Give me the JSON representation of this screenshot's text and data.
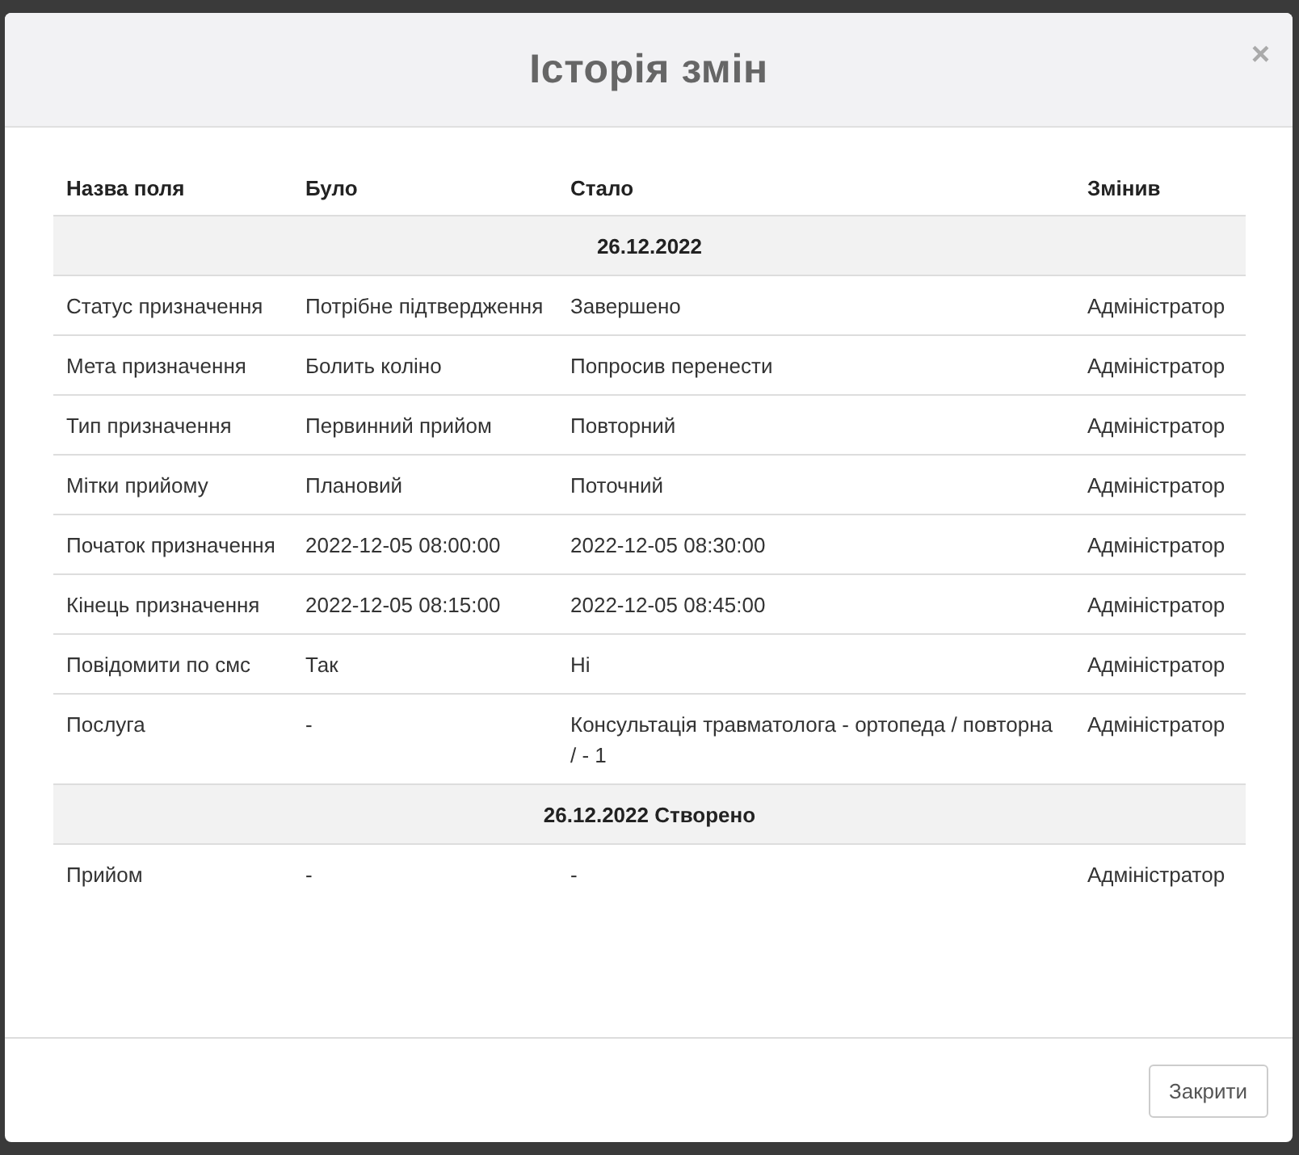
{
  "dialog": {
    "title": "Історія змін",
    "close_icon": "×"
  },
  "table": {
    "columns": [
      "Назва поля",
      "Було",
      "Стало",
      "Змінив"
    ],
    "groups": [
      {
        "title": "26.12.2022",
        "rows": [
          [
            "Статус призначення",
            "Потрібне підтвердження",
            "Завершено",
            "Адміністратор"
          ],
          [
            "Мета призначення",
            "Болить коліно",
            "Попросив перенести",
            "Адміністратор"
          ],
          [
            "Тип призначення",
            "Первинний прийом",
            "Повторний",
            "Адміністратор"
          ],
          [
            "Мітки прийому",
            "Плановий",
            "Поточний",
            "Адміністратор"
          ],
          [
            "Початок призначення",
            "2022-12-05 08:00:00",
            "2022-12-05 08:30:00",
            "Адміністратор"
          ],
          [
            "Кінець призначення",
            "2022-12-05 08:15:00",
            "2022-12-05 08:45:00",
            "Адміністратор"
          ],
          [
            "Повідомити по смс",
            "Так",
            "Ні",
            "Адміністратор"
          ],
          [
            "Послуга",
            "-",
            "Консультація травматолога - ортопеда / повторна / - 1",
            "Адміністратор"
          ]
        ]
      },
      {
        "title": "26.12.2022 Створено",
        "rows": [
          [
            "Прийом",
            "-",
            "-",
            "Адміністратор"
          ]
        ]
      }
    ]
  },
  "footer": {
    "buttons": [
      "Закрити"
    ]
  }
}
